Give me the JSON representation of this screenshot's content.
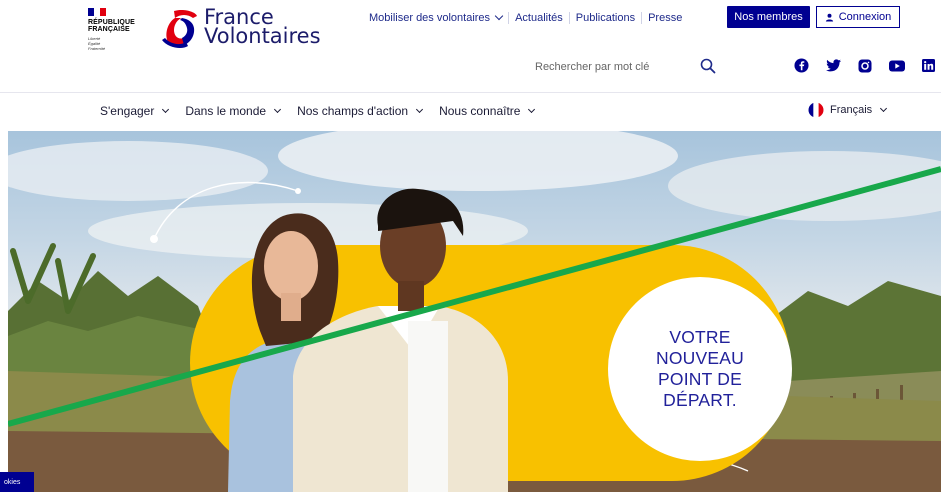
{
  "brand": {
    "republic_title": "RÉPUBLIQUE\nFRANÇAISE",
    "republic_motto": "Liberté\nÉgalité\nFraternité",
    "name_line1": "France",
    "name_line2": "Volontaires",
    "colors": {
      "navy": "#000091",
      "red": "#e1000f",
      "yellow": "#f8c100",
      "text": "#1c1c6a"
    }
  },
  "topnav": {
    "items": [
      {
        "label": "Mobiliser des volontaires",
        "dropdown": true
      },
      {
        "label": "Actualités"
      },
      {
        "label": "Publications"
      },
      {
        "label": "Presse"
      }
    ],
    "members_label": "Nos membres",
    "login_label": "Connexion"
  },
  "search": {
    "placeholder": "Rechercher par mot clé",
    "icon": "search-icon"
  },
  "socials": [
    "facebook-icon",
    "twitter-icon",
    "instagram-icon",
    "youtube-icon",
    "linkedin-icon"
  ],
  "mainnav": {
    "items": [
      {
        "label": "S'engager"
      },
      {
        "label": "Dans le monde"
      },
      {
        "label": "Nos champs d'action"
      },
      {
        "label": "Nous connaître"
      }
    ],
    "language": "Français"
  },
  "hero": {
    "tagline": [
      "VOTRE",
      "NOUVEAU",
      "POINT DE",
      "DÉPART."
    ]
  },
  "cookies_label": "okies"
}
